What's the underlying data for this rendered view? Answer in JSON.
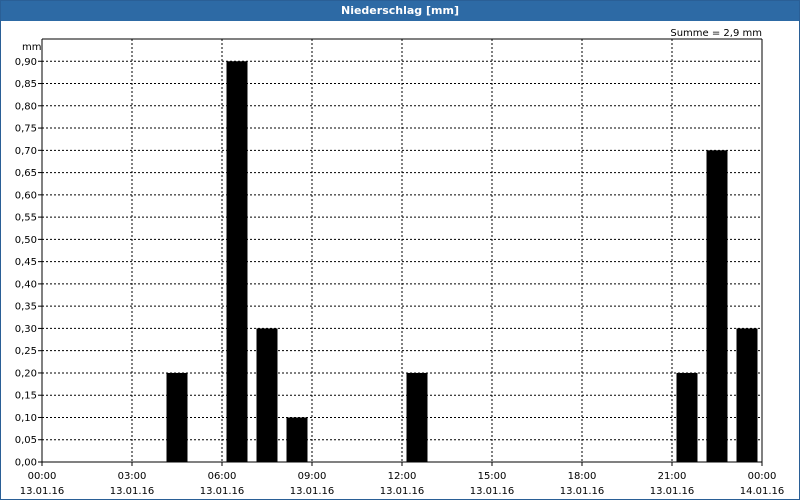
{
  "window": {
    "title": "Niederschlag [mm]"
  },
  "summary_text": "Summe = 2,9 mm",
  "chart_data": {
    "type": "bar",
    "title": "Niederschlag [mm]",
    "ylabel": "mm",
    "xlabel": "",
    "ylim": [
      0,
      0.95
    ],
    "y_ticks": [
      "0,00",
      "0,05",
      "0,10",
      "0,15",
      "0,20",
      "0,25",
      "0,30",
      "0,35",
      "0,40",
      "0,45",
      "0,50",
      "0,55",
      "0,60",
      "0,65",
      "0,70",
      "0,75",
      "0,80",
      "0,85",
      "0,90"
    ],
    "x_range_hours": [
      0,
      24
    ],
    "x_ticks": [
      {
        "time": "00:00",
        "date": "13.01.16"
      },
      {
        "time": "03:00",
        "date": "13.01.16"
      },
      {
        "time": "06:00",
        "date": "13.01.16"
      },
      {
        "time": "09:00",
        "date": "13.01.16"
      },
      {
        "time": "12:00",
        "date": "13.01.16"
      },
      {
        "time": "15:00",
        "date": "13.01.16"
      },
      {
        "time": "18:00",
        "date": "13.01.16"
      },
      {
        "time": "21:00",
        "date": "13.01.16"
      },
      {
        "time": "00:00",
        "date": "14.01.16"
      }
    ],
    "bars": [
      {
        "start": "13.01.16 04:00",
        "end": "13.01.16 05:00",
        "value": 0.2
      },
      {
        "start": "13.01.16 06:00",
        "end": "13.01.16 07:00",
        "value": 0.9
      },
      {
        "start": "13.01.16 07:00",
        "end": "13.01.16 08:00",
        "value": 0.3
      },
      {
        "start": "13.01.16 08:00",
        "end": "13.01.16 09:00",
        "value": 0.1
      },
      {
        "start": "13.01.16 12:00",
        "end": "13.01.16 13:00",
        "value": 0.2
      },
      {
        "start": "13.01.16 21:00",
        "end": "13.01.16 22:00",
        "value": 0.2
      },
      {
        "start": "13.01.16 22:00",
        "end": "13.01.16 23:00",
        "value": 0.7
      },
      {
        "start": "13.01.16 23:00",
        "end": "14.01.16 00:00",
        "value": 0.3
      }
    ],
    "grid": true,
    "bar_color": "#000000"
  }
}
